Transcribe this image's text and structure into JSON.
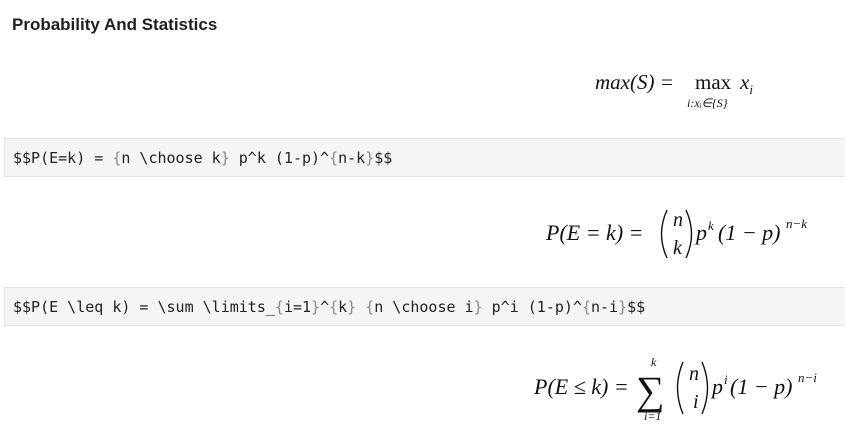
{
  "heading": "Probability And Statistics",
  "max_eq": {
    "lhs": "max(S) =",
    "op": "max",
    "subscript": "i:xᵢ∈{S}",
    "rhs": "x",
    "rhs_sub": "i"
  },
  "code_blocks": [
    {
      "pre": "$$P(E=k) = ",
      "b1": "{",
      "t1": "n \\choose k",
      "b2": "}",
      "t2": " p^k (1-p)^",
      "b3": "{",
      "t3": "n-k",
      "b4": "}",
      "post": "$$"
    },
    {
      "pre": "$$P(E \\leq k) = \\sum \\limits_",
      "b1": "{",
      "t1": "i=1",
      "b2": "}",
      "t2": "^",
      "b3": "{",
      "t3": "k",
      "b4": "}",
      "t4": " ",
      "b5": "{",
      "t5": "n \\choose i",
      "b6": "}",
      "t6": " p^i (1-p)^",
      "b7": "{",
      "t7": "n-i",
      "b8": "}",
      "post": "$$"
    }
  ],
  "eq_binomial": {
    "lhs": "P(E = k) =",
    "top": "n",
    "bottom": "k",
    "base": "p",
    "exp1": "k",
    "mid": "(1 − p)",
    "exp2": "n−k"
  },
  "eq_cumulative": {
    "lhs": "P(E ≤ k) =",
    "sum_top": "k",
    "sum_symbol": "∑",
    "sum_bottom": "i=1",
    "top": "n",
    "bottom": "i",
    "base": "p",
    "exp1": "i",
    "mid": "(1 − p)",
    "exp2": "n−i"
  }
}
